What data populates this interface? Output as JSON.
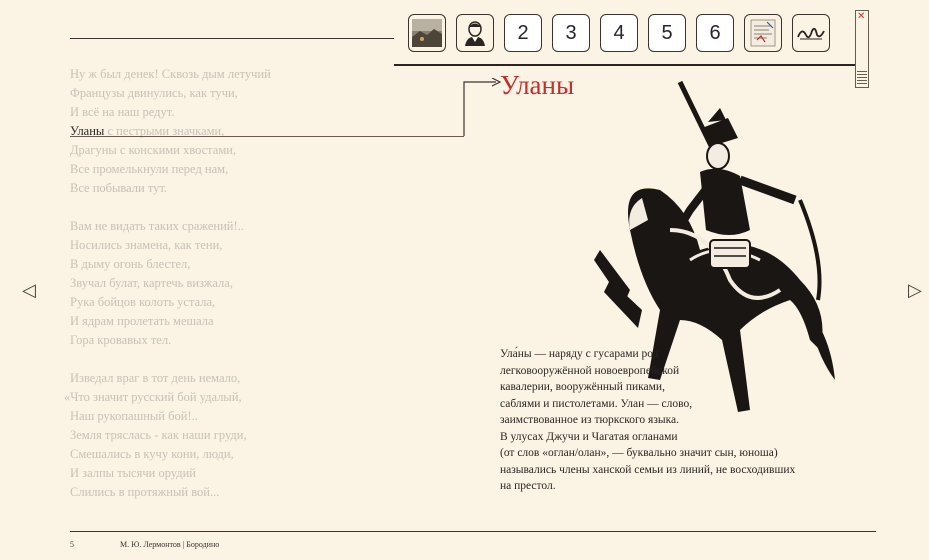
{
  "toolbar": {
    "buttons": [
      {
        "type": "image",
        "icon": "landscape-painting-icon"
      },
      {
        "type": "image",
        "icon": "portrait-icon"
      },
      {
        "type": "number",
        "label": "2"
      },
      {
        "type": "number",
        "label": "3"
      },
      {
        "type": "number",
        "label": "4"
      },
      {
        "type": "number",
        "label": "5"
      },
      {
        "type": "number",
        "label": "6"
      },
      {
        "type": "image",
        "icon": "manuscript-icon"
      },
      {
        "type": "image",
        "icon": "signature-icon"
      }
    ]
  },
  "poem": {
    "stanzas": [
      [
        "Ну ж был денек! Сквозь дым летучий",
        "Французы двинулись, как тучи,",
        "И всё на наш редут.",
        "Уланы с пестрыми значками,",
        "Драгуны с конскими хвостами,",
        "Все промелькнули перед нам,",
        "Все побывали тут."
      ],
      [
        "Вам не видать таких сражений!..",
        "Носились знамена, как тени,",
        "В дыму огонь блестел,",
        "Звучал булат, картечь визжала,",
        "Рука бойцов колоть устала,",
        "И ядрам пролетать мешала",
        "Гора кровавых тел."
      ],
      [
        "Изведал враг в тот день немало,",
        "«Что значит русский бой удалый,",
        "Наш рукопашный бой!..",
        "Земля тряслась - как наши груди,",
        "Смешались в кучу кони, люди,",
        "И залпы тысячи орудий",
        "Слились в протяжный вой..."
      ]
    ],
    "highlighted_word": "Уланы",
    "highlighted_rest": " с пестрыми значками,"
  },
  "glossary": {
    "headword": "Уланы",
    "definition_lines": [
      "Ула́ны — наряду с гусарами род",
      "легковооружённой новоевропейской",
      "кавалерии, вооружённый пиками,",
      "саблями и пистолетами. Улан — слово,",
      "заимствованное из тюркского языка.",
      "В улусах Джучи и Чагатая огланами",
      "(от слов «оглан/олан», — буквально значит сын, юноша)",
      "назывались члены ханской семьи из линий, не восходивших",
      "на престол."
    ]
  },
  "nav": {
    "prev": "◁",
    "next": "▷"
  },
  "footer": {
    "page": "5",
    "author_title": "М. Ю. Лермонтов | Бородино"
  },
  "colors": {
    "accent": "#c0302e",
    "background": "#fbf3e4",
    "text": "#2a2522",
    "faded_text": "#c9c0b7"
  }
}
